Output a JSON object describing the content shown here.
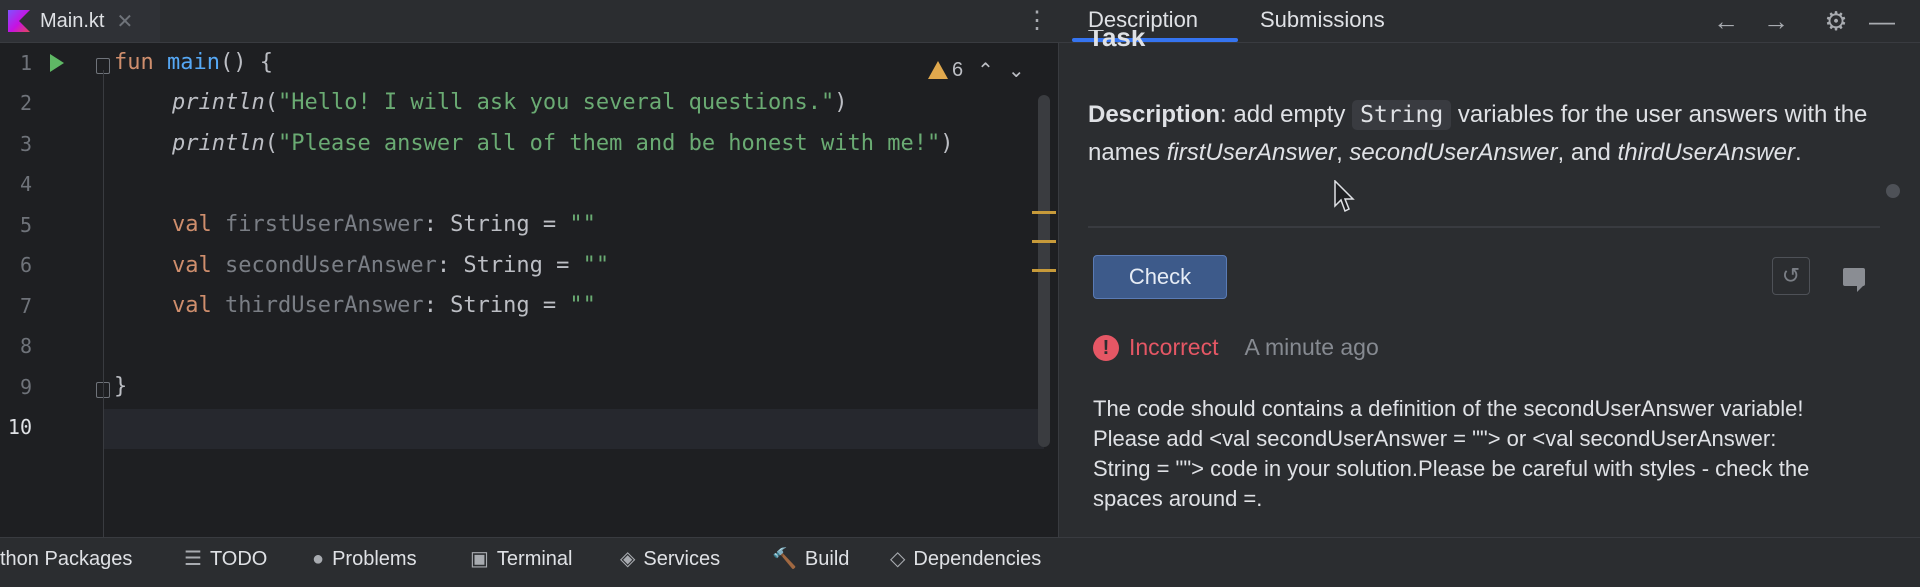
{
  "editor": {
    "tab_label": "Main.kt",
    "tab_close": "✕",
    "menu_glyph": "⋮",
    "inspection": {
      "warning_count": "6",
      "up": "⌃",
      "down": "⌄"
    },
    "line_numbers": [
      "1",
      "2",
      "3",
      "4",
      "5",
      "6",
      "7",
      "8",
      "9",
      "10"
    ],
    "code": {
      "l1_kw": "fun",
      "l1_fn": "main",
      "l1_rest": "() {",
      "l2_call": "println",
      "l2_open": "(",
      "l2_str": "\"Hello! I will ask you several questions.\"",
      "l2_close": ")",
      "l3_call": "println",
      "l3_open": "(",
      "l3_str": "\"Please answer all of them and be honest with me!\"",
      "l3_close": ")",
      "l5_kw": "val",
      "l5_id": "firstUserAnswer",
      "l5_type": ": String = ",
      "l5_str": "\"\"",
      "l6_kw": "val",
      "l6_id": "secondUserAnswer",
      "l6_type": ": String = ",
      "l6_str": "\"\"",
      "l7_kw": "val",
      "l7_id": "thirdUserAnswer",
      "l7_type": ": String = ",
      "l7_str": "\"\"",
      "l9": "}"
    }
  },
  "panel": {
    "tabs": [
      "Description",
      "Submissions"
    ],
    "icons": {
      "back": "←",
      "forward": "→",
      "settings": "⚙",
      "minimize": "—"
    },
    "task_heading": "Task",
    "description": {
      "label": "Description",
      "p1": ": add empty ",
      "code": "String",
      "p2": " variables for the user answers with the names ",
      "n1": "firstUserAnswer",
      "sep1": ", ",
      "n2": "secondUserAnswer",
      "sep2": ", and ",
      "n3": "thirdUserAnswer",
      "end": "."
    },
    "check_label": "Check",
    "reset_glyph": "↺",
    "status": {
      "icon": "!",
      "text": "Incorrect",
      "time": "A minute ago"
    },
    "message": "The code should contains a definition of the secondUserAnswer variable! Please add <val secondUserAnswer = \"\"> or <val secondUserAnswer: String = \"\"> code in your solution.Please be careful with styles - check the spaces around =."
  },
  "bottom_toolbar": [
    {
      "label": "thon Packages",
      "icon": ""
    },
    {
      "label": "TODO",
      "icon": "☰"
    },
    {
      "label": "Problems",
      "icon": "●"
    },
    {
      "label": "Terminal",
      "icon": "▣"
    },
    {
      "label": "Services",
      "icon": "◈"
    },
    {
      "label": "Build",
      "icon": "🔨"
    },
    {
      "label": "Dependencies",
      "icon": "◇"
    }
  ],
  "colors": {
    "accent": "#3574f0",
    "error": "#e55765",
    "warning": "#e0a84d",
    "run": "#5fb865"
  }
}
